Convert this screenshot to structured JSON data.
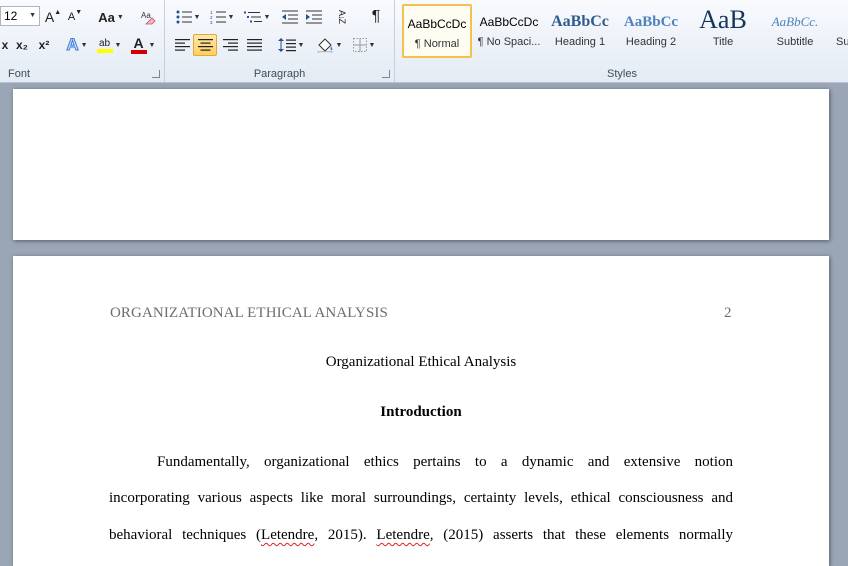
{
  "ribbon": {
    "font": {
      "label": "Font",
      "size_value": "12",
      "grow_label": "A",
      "shrink_label": "A",
      "case_label": "Aa",
      "subscript_label": "x₂",
      "superscript_label": "x²",
      "text_effects_label": "A",
      "highlight_label": "ab",
      "font_color_label": "A",
      "colors": {
        "highlight": "#ffff00",
        "font_color": "#d00000"
      }
    },
    "paragraph": {
      "label": "Paragraph",
      "sort_label": "A↓Z",
      "pilcrow": "¶"
    },
    "styles": {
      "label": "Styles",
      "items": [
        {
          "sample": "AaBbCcDc",
          "name": "¶ Normal"
        },
        {
          "sample": "AaBbCcDc",
          "name": "¶ No Spaci..."
        },
        {
          "sample": "AaBbCc",
          "name": "Heading 1"
        },
        {
          "sample": "AaBbCc",
          "name": "Heading 2"
        },
        {
          "sample": "AaB",
          "name": "Title"
        },
        {
          "sample": "AaBbCc.",
          "name": "Subtitle"
        },
        {
          "sample": "",
          "name": "Su"
        }
      ]
    }
  },
  "document": {
    "header_text": "ORGANIZATIONAL ETHICAL ANALYSIS",
    "page_number": "2",
    "title": "Organizational Ethical Analysis",
    "heading": "Introduction",
    "para": {
      "line1": "Fundamentally, organizational ethics pertains to a dynamic and extensive notion",
      "line2": "incorporating various aspects like moral surroundings, certainty levels, ethical consciousness and",
      "line3_a": "behavioral techniques (",
      "line3_b": "Letendre",
      "line3_c": ", 2015). ",
      "line3_d": "Letendre",
      "line3_e": ", (2015) asserts that these elements normally"
    }
  }
}
